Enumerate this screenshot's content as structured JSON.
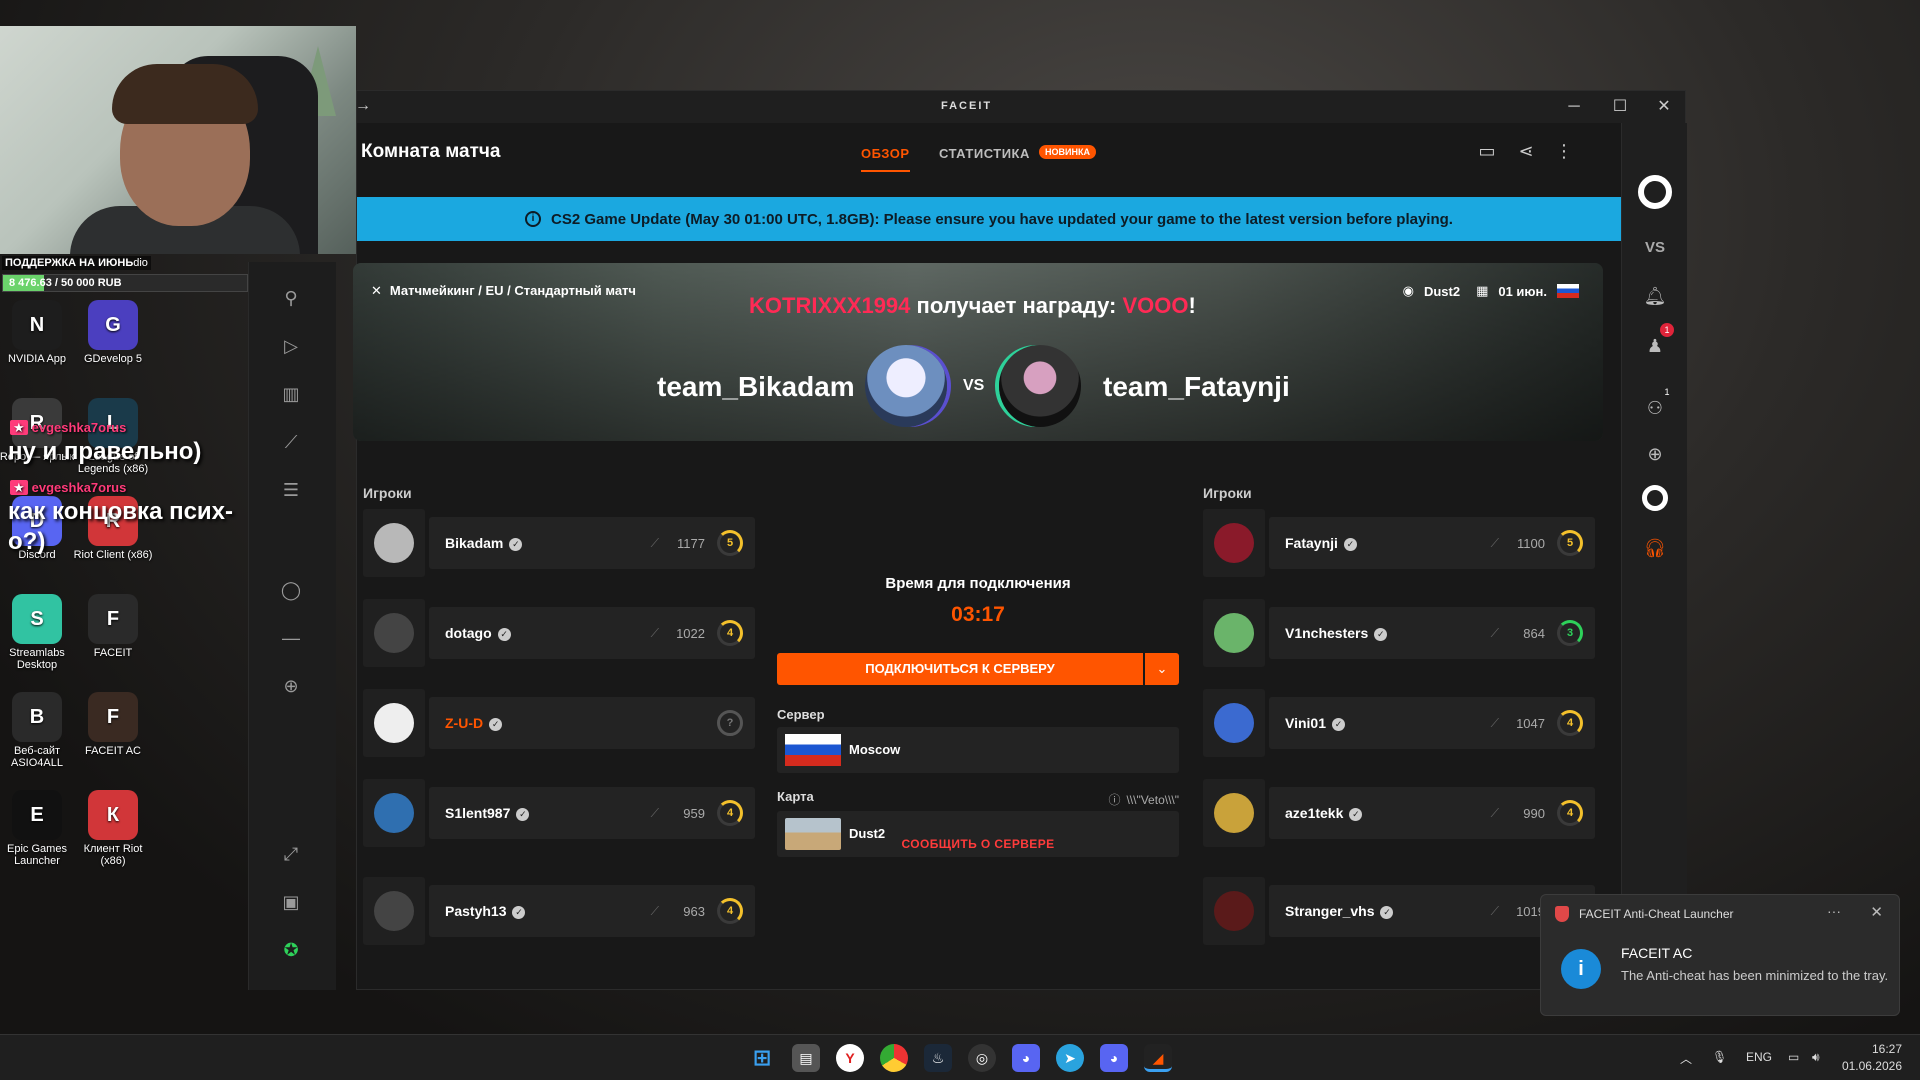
{
  "stream_overlay": {
    "donation_title": "ПОДДЕРЖКА НА ИЮНЬ",
    "donation_title_suffix": "dio",
    "donation_progress": "8 476.63 / 50 000 RUB",
    "donation_fraction": 0.17,
    "chat_user_1": "evgeshka7orus",
    "chat_msg_1": "ну и правельно)",
    "chat_user_2": "evgeshka7orus",
    "chat_msg_2": "как концовка псих-",
    "chat_msg_2b": "о?)"
  },
  "desktop_icons": [
    {
      "label": "NVIDIA App",
      "icon": "nvidia-icon",
      "color": "#1d1d1d"
    },
    {
      "label": "GDevelop 5",
      "icon": "gdevelop-icon",
      "color": "#4b3fbf"
    },
    {
      "label": "Repo — ярлык",
      "icon": "shortcut-icon",
      "color": "#3a3a3a"
    },
    {
      "label": "League of Legends (x86)",
      "icon": "league-icon",
      "color": "#1a3a4a"
    },
    {
      "label": "Discord",
      "icon": "discord-icon",
      "color": "#5865f2"
    },
    {
      "label": "Riot Client (x86)",
      "icon": "riot-icon",
      "color": "#d13639"
    },
    {
      "label": "Streamlabs Desktop",
      "icon": "streamlabs-icon",
      "color": "#31c3a2"
    },
    {
      "label": "FACEIT",
      "icon": "faceit-icon",
      "color": "#2a2a2a"
    },
    {
      "label": "Веб-сайт ASIO4ALL",
      "icon": "asio-icon",
      "color": "#2a2a2a"
    },
    {
      "label": "FACEIT AC",
      "icon": "faceit-ac-icon",
      "color": "#3a2a22"
    },
    {
      "label": "Epic Games Launcher",
      "icon": "epic-icon",
      "color": "#111"
    },
    {
      "label": "Клиент Riot (x86)",
      "icon": "riot-icon",
      "color": "#d13639"
    }
  ],
  "window": {
    "brand": "FACEIT",
    "page_title": "Комната матча",
    "tab_overview": "ОБЗОР",
    "tab_stats": "СТАТИСТИКА",
    "badge_new": "НОВИНКА",
    "banner": "CS2 Game Update (May 30 01:00 UTC, 1.8GB): Please ensure you have updated your game to the latest version before playing."
  },
  "match": {
    "breadcrumb": "Матчмейкинг / EU / Стандартный матч",
    "award_user": "KOTRIXXX1994",
    "award_text": "получает награду",
    "award_item": "VOOO",
    "award_end": "!",
    "map": "Dust2",
    "date": "01 июн.",
    "team1": "team_Bikadam",
    "team2": "team_Fataynji",
    "vs": "VS",
    "players_label": "Игроки",
    "connect_time_label": "Время для подключения",
    "timer": "03:17",
    "connect_button": "ПОДКЛЮЧИТЬСЯ К СЕРВЕРУ",
    "server_label": "Сервер",
    "server": "Moscow",
    "map_label": "Карта",
    "veto": "\\\\\\\"Veto\\\\\\\"",
    "report": "СООБЩИТЬ О СЕРВЕРЕ"
  },
  "team1_players": [
    {
      "name": "Bikadam",
      "elo": "1177",
      "level": "5",
      "lvl_class": "lvl5",
      "color": "#b8b8b8"
    },
    {
      "name": "dotago",
      "elo": "1022",
      "level": "4",
      "lvl_class": "lvl4",
      "color": "#444"
    },
    {
      "name": "Z-U-D",
      "elo": "",
      "level": "?",
      "lvl_class": "lvl0",
      "color": "#eee"
    },
    {
      "name": "S1lent987",
      "elo": "959",
      "level": "4",
      "lvl_class": "lvl4",
      "color": "#2f6fb0"
    },
    {
      "name": "Pastyh13",
      "elo": "963",
      "level": "4",
      "lvl_class": "lvl4",
      "color": "#444"
    }
  ],
  "team2_players": [
    {
      "name": "Fataynji",
      "elo": "1100",
      "level": "5",
      "lvl_class": "lvl5",
      "color": "#8a1a2a"
    },
    {
      "name": "V1nchesters",
      "elo": "864",
      "level": "3",
      "lvl_class": "lvl3",
      "color": "#6ab46a"
    },
    {
      "name": "Vini01",
      "elo": "1047",
      "level": "4",
      "lvl_class": "lvl4",
      "color": "#3b6ad0"
    },
    {
      "name": "aze1tekk",
      "elo": "990",
      "level": "4",
      "lvl_class": "lvl4",
      "color": "#c9a23a"
    },
    {
      "name": "Stranger_vhs",
      "elo": "1019",
      "level": "",
      "lvl_class": "lvl4",
      "color": "#5a1a1a"
    }
  ],
  "rail": {
    "vs_label": "VS",
    "notif_count": "1",
    "party_count": "1"
  },
  "toast": {
    "app": "FACEIT Anti-Cheat Launcher",
    "title": "FACEIT AC",
    "body": "The Anti-cheat has been minimized to the tray."
  },
  "taskbar": {
    "lang": "ENG",
    "time": "16:27",
    "date": "01.06.2026"
  }
}
